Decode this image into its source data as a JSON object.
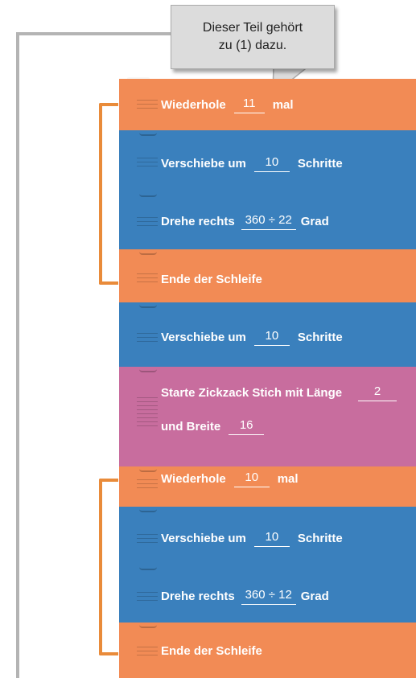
{
  "callout": {
    "line1": "Dieser Teil gehört",
    "line2": "zu (1) dazu."
  },
  "colors": {
    "loop": "#f28b55",
    "motion": "#3a80bd",
    "stitch": "#c86d9e",
    "bracket_gray": "#b4b4b4",
    "bracket_orange": "#e98b3a"
  },
  "blocks": [
    {
      "kind": "loop-start",
      "parts": {
        "kw": "Wiederhole",
        "value": "11",
        "suffix": "mal"
      }
    },
    {
      "kind": "move",
      "parts": {
        "kw": "Verschiebe um",
        "value": "10",
        "suffix": "Schritte"
      }
    },
    {
      "kind": "turn",
      "parts": {
        "kw": "Drehe rechts",
        "value": "360 ÷ 22",
        "suffix": "Grad"
      }
    },
    {
      "kind": "loop-end",
      "parts": {
        "kw": "Ende der Schleife"
      }
    },
    {
      "kind": "move",
      "parts": {
        "kw": "Verschiebe um",
        "value": "10",
        "suffix": "Schritte"
      }
    },
    {
      "kind": "zigzag",
      "parts": {
        "kw": "Starte Zickzack Stich mit Länge",
        "value": "2",
        "kw2": "und Breite",
        "value2": "16"
      }
    },
    {
      "kind": "loop-start",
      "parts": {
        "kw": "Wiederhole",
        "value": "10",
        "suffix": "mal"
      }
    },
    {
      "kind": "move",
      "parts": {
        "kw": "Verschiebe um",
        "value": "10",
        "suffix": "Schritte"
      }
    },
    {
      "kind": "turn",
      "parts": {
        "kw": "Drehe rechts",
        "value": "360 ÷ 12",
        "suffix": "Grad"
      }
    },
    {
      "kind": "loop-end",
      "parts": {
        "kw": "Ende der Schleife"
      }
    }
  ]
}
